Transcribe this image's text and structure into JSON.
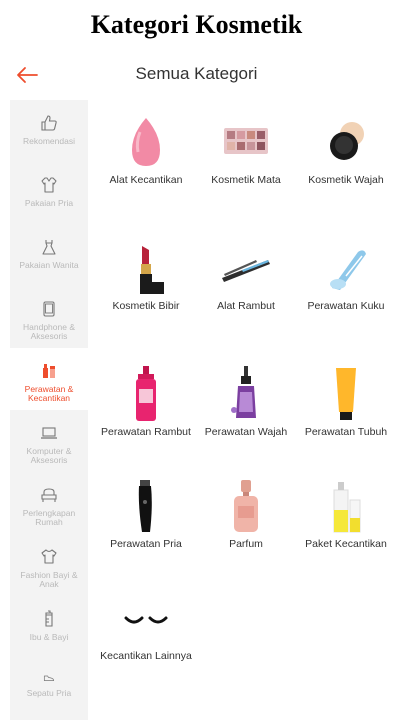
{
  "caption": "Kategori Kosmetik",
  "header": {
    "title": "Semua Kategori",
    "accent_color": "#ee4d2d"
  },
  "sidebar": {
    "items": [
      {
        "label": "Rekomendasi",
        "icon": "thumbs-up-icon"
      },
      {
        "label": "Pakaian Pria",
        "icon": "shirt-icon"
      },
      {
        "label": "Pakaian Wanita",
        "icon": "dress-icon"
      },
      {
        "label": "Handphone & Aksesoris",
        "icon": "phone-icon"
      },
      {
        "label": "Perawatan & Kecantikan",
        "icon": "cosmetics-icon",
        "active": true
      },
      {
        "label": "Komputer & Aksesoris",
        "icon": "laptop-icon"
      },
      {
        "label": "Perlengkapan Rumah",
        "icon": "sofa-icon"
      },
      {
        "label": "Fashion Bayi & Anak",
        "icon": "baby-clothes-icon"
      },
      {
        "label": "Ibu & Bayi",
        "icon": "baby-bottle-icon"
      },
      {
        "label": "Sepatu Pria",
        "icon": "shoe-icon"
      }
    ]
  },
  "categories": [
    {
      "label": "Alat Kecantikan",
      "icon": "makeup-sponge-icon"
    },
    {
      "label": "Kosmetik Mata",
      "icon": "eyeshadow-palette-icon"
    },
    {
      "label": "Kosmetik Wajah",
      "icon": "compact-powder-icon"
    },
    {
      "label": "Kosmetik Bibir",
      "icon": "lipstick-icon"
    },
    {
      "label": "Alat Rambut",
      "icon": "hair-straightener-icon"
    },
    {
      "label": "Perawatan Kuku",
      "icon": "nail-clipper-icon"
    },
    {
      "label": "Perawatan Rambut",
      "icon": "shampoo-bottle-icon"
    },
    {
      "label": "Perawatan Wajah",
      "icon": "serum-bottle-icon"
    },
    {
      "label": "Perawatan Tubuh",
      "icon": "lotion-tube-icon"
    },
    {
      "label": "Perawatan Pria",
      "icon": "hair-trimmer-icon"
    },
    {
      "label": "Parfum",
      "icon": "perfume-icon"
    },
    {
      "label": "Paket Kecantikan",
      "icon": "beauty-set-icon"
    },
    {
      "label": "Kecantikan Lainnya",
      "icon": "false-eyelashes-icon"
    }
  ]
}
